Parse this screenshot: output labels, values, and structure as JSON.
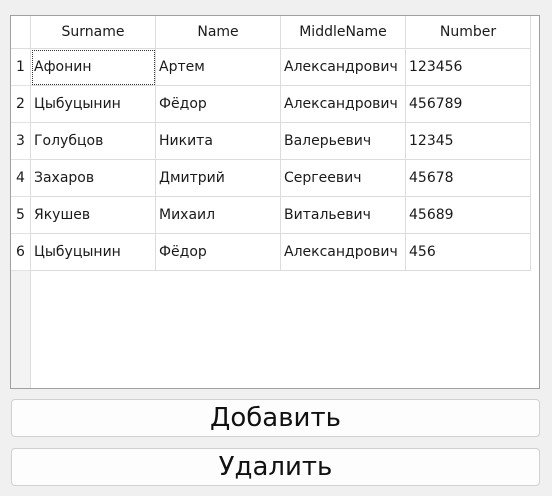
{
  "table": {
    "columns": [
      "Surname",
      "Name",
      "MiddleName",
      "Number"
    ],
    "row_numbers": [
      "1",
      "2",
      "3",
      "4",
      "5",
      "6"
    ],
    "rows": [
      [
        "Афонин",
        "Артем",
        "Александрович",
        "123456"
      ],
      [
        "Цыбуцынин",
        "Фёдор",
        "Александрович",
        "456789"
      ],
      [
        "Голубцов",
        "Никита",
        "Валерьевич",
        "12345"
      ],
      [
        "Захаров",
        "Дмитрий",
        "Сергеевич",
        "45678"
      ],
      [
        "Якушев",
        "Михаил",
        "Витальевич",
        "45689"
      ],
      [
        "Цыбуцынин",
        "Фёдор",
        "Александрович",
        "456"
      ]
    ]
  },
  "buttons": {
    "add_label": "Добавить",
    "delete_label": "Удалить"
  }
}
